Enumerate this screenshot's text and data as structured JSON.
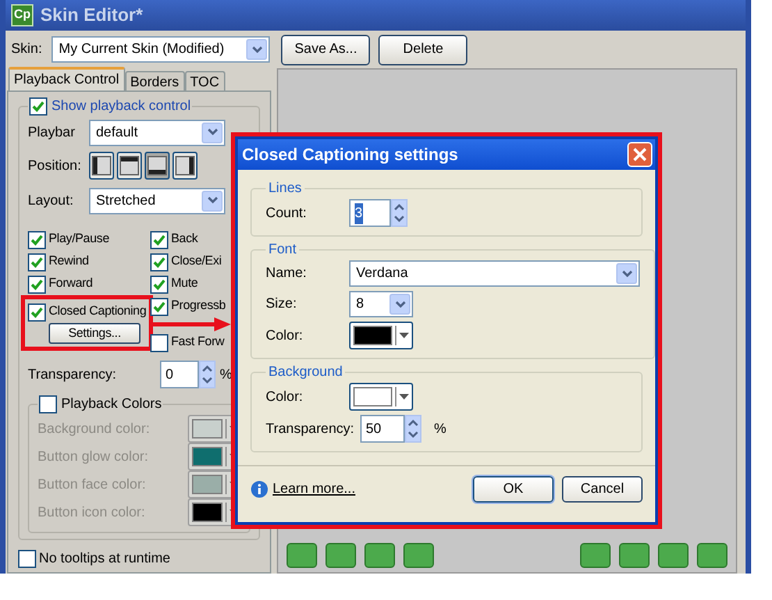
{
  "window": {
    "app_icon": "Cp",
    "title": "Skin Editor*"
  },
  "skin": {
    "label": "Skin:",
    "value": "My Current Skin (Modified)"
  },
  "buttons": [
    "Save As...",
    "Delete"
  ],
  "tabs": [
    {
      "label": "Playback Control",
      "selected": true
    },
    {
      "label": "Borders",
      "selected": false
    },
    {
      "label": "TOC",
      "selected": false
    }
  ],
  "playback": {
    "show": {
      "label": "Show playback control",
      "checked": true
    },
    "playbar": {
      "label": "Playbar",
      "value": "default"
    },
    "position": {
      "label": "Position:",
      "options": [
        {
          "selected": false
        },
        {
          "selected": false
        },
        {
          "selected": true
        },
        {
          "selected": false
        }
      ]
    },
    "layout": {
      "label": "Layout:",
      "value": "Stretched"
    },
    "checkboxes_left": [
      {
        "label": "Play/Pause",
        "checked": true
      },
      {
        "label": "Rewind",
        "checked": true
      },
      {
        "label": "Forward",
        "checked": true
      },
      {
        "label": "Closed Captioning",
        "checked": true
      }
    ],
    "checkboxes_right": [
      {
        "label": "Back",
        "checked": true
      },
      {
        "label": "Close/Exi",
        "checked": true
      },
      {
        "label": "Mute",
        "checked": true
      },
      {
        "label": "Progressb",
        "checked": true
      },
      {
        "label": "Fast Forw",
        "checked": false
      }
    ],
    "settings_button": "Settings...",
    "transparency": {
      "label": "Transparency:",
      "value": "0",
      "unit": "%"
    },
    "colors": {
      "label": "Playback Colors",
      "checked": false,
      "rows": [
        {
          "label": "Background color:",
          "color": "#c8d0cc"
        },
        {
          "label": "Button glow color:",
          "color": "#0f6e6e"
        },
        {
          "label": "Button face color:",
          "color": "#9aaea8"
        },
        {
          "label": "Button icon color:",
          "color": "#000000"
        }
      ]
    },
    "no_tooltips": {
      "label": "No tooltips at runtime",
      "checked": false
    }
  },
  "dialog": {
    "title": "Closed Captioning settings",
    "lines": {
      "title": "Lines",
      "count_label": "Count:",
      "count": "3"
    },
    "font": {
      "title": "Font",
      "name_label": "Name:",
      "name": "Verdana",
      "size_label": "Size:",
      "size": "8",
      "color_label": "Color:",
      "color": "#000000"
    },
    "background": {
      "title": "Background",
      "color_label": "Color:",
      "color": "#ffffff",
      "transparency_label": "Transparency:",
      "transparency": "50",
      "unit": "%"
    },
    "learn_more": "Learn more...",
    "buttons": [
      "OK",
      "Cancel"
    ]
  }
}
